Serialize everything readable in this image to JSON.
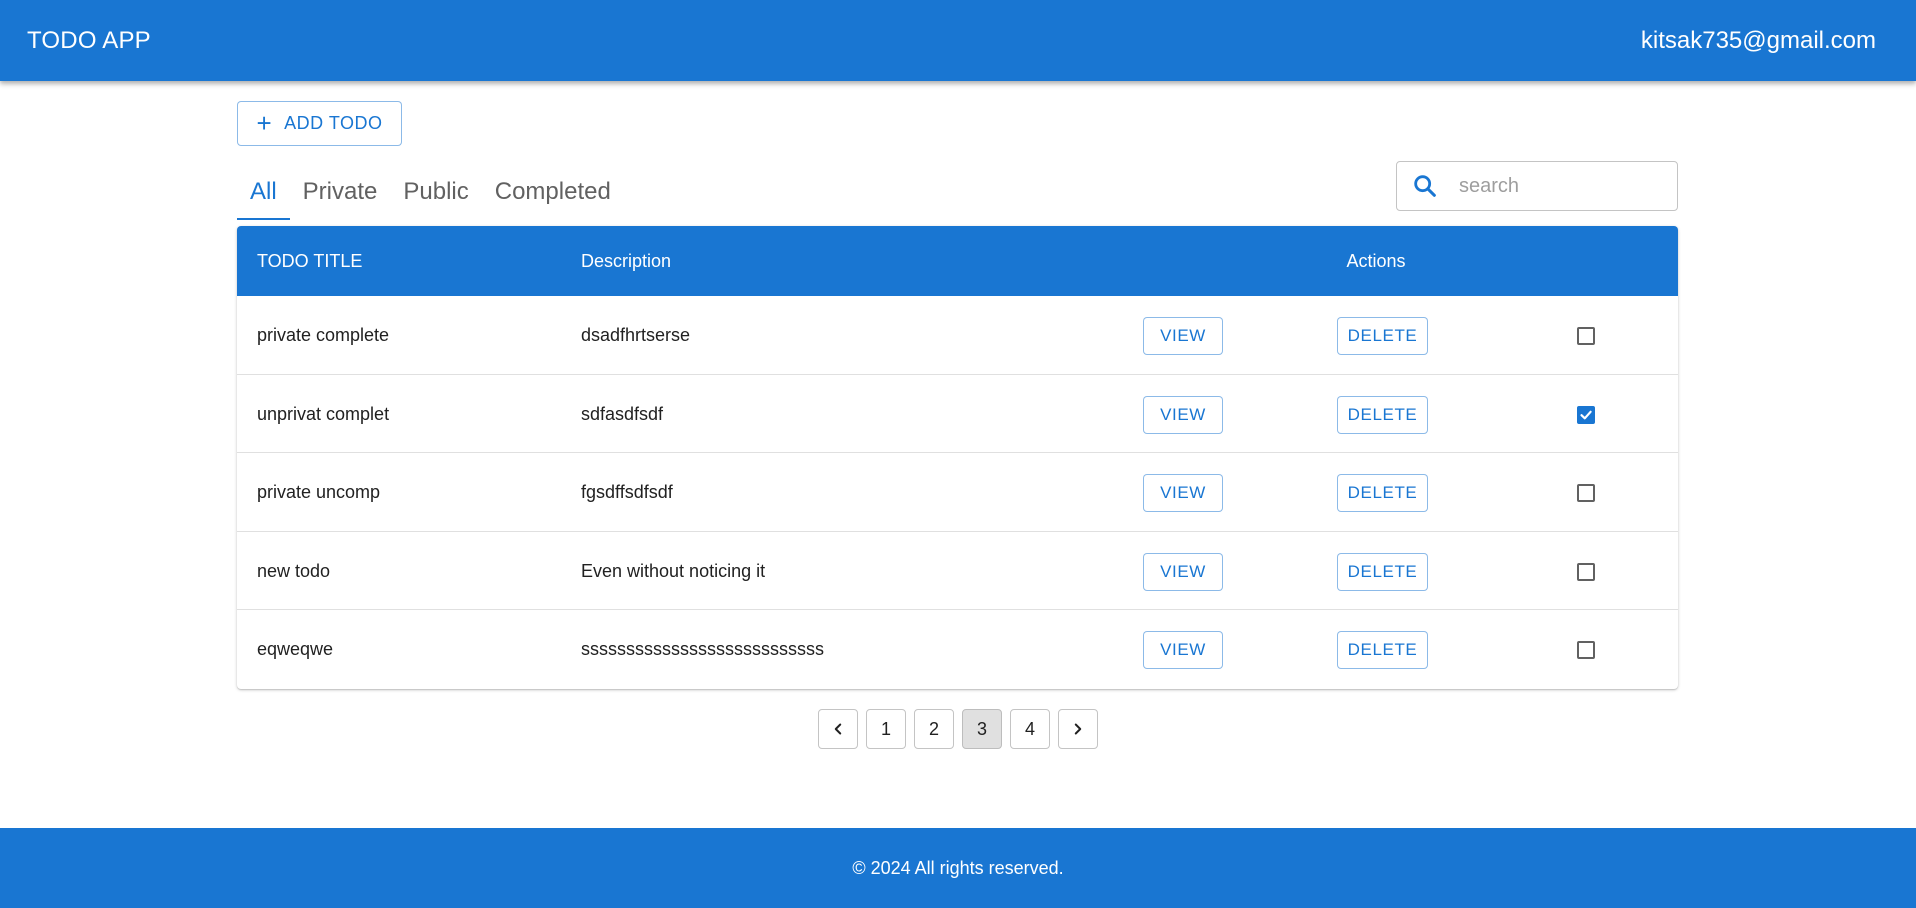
{
  "header": {
    "app_title": "TODO APP",
    "user_email": "kitsak735@gmail.com"
  },
  "toolbar": {
    "add_label": "ADD TODO",
    "add_icon": "plus-icon"
  },
  "tabs": [
    {
      "label": "All",
      "active": true
    },
    {
      "label": "Private",
      "active": false
    },
    {
      "label": "Public",
      "active": false
    },
    {
      "label": "Completed",
      "active": false
    }
  ],
  "search": {
    "placeholder": "search",
    "value": "",
    "icon": "search-icon"
  },
  "table": {
    "columns": {
      "title": "TODO TITLE",
      "description": "Description",
      "actions": "Actions"
    },
    "rows": [
      {
        "title": "private complete",
        "description": "dsadfhrtserse",
        "view_label": "VIEW",
        "delete_label": "DELETE",
        "completed": false
      },
      {
        "title": "unprivat complet",
        "description": "sdfasdfsdf",
        "view_label": "VIEW",
        "delete_label": "DELETE",
        "completed": true
      },
      {
        "title": "private uncomp",
        "description": "fgsdffsdfsdf",
        "view_label": "VIEW",
        "delete_label": "DELETE",
        "completed": false
      },
      {
        "title": "new todo",
        "description": "Even without noticing it",
        "view_label": "VIEW",
        "delete_label": "DELETE",
        "completed": false
      },
      {
        "title": "eqweqwe",
        "description": "sssssssssssssssssssssssssss",
        "view_label": "VIEW",
        "delete_label": "DELETE",
        "completed": false
      }
    ]
  },
  "pagination": {
    "pages": [
      "1",
      "2",
      "3",
      "4"
    ],
    "current": "3"
  },
  "footer": {
    "text": "© 2024 All rights reserved."
  },
  "colors": {
    "primary": "#1976d2",
    "background": "#ffffff"
  }
}
